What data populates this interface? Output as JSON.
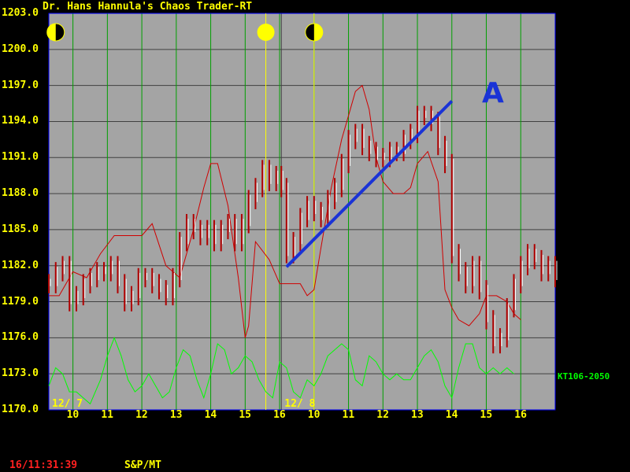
{
  "title": "Dr. Hans Hannula's Chaos Trader-RT",
  "bottom": {
    "timestamp": "16/11:31:39",
    "instrument": "S&P/MT"
  },
  "oscillator_label": "KT106-2050",
  "annotation_label": "A",
  "colors": {
    "plot_bg": "#a4a4a4",
    "price_bar": "#b00000",
    "price_bar_alt": "#ffffff",
    "red_curve": "#d00000",
    "green_curve": "#00ff00",
    "trendline": "#1a33d6",
    "grid_h": "#404040",
    "grid_v": "#00a000",
    "event_line": "#ffff00",
    "text": "#ffff00"
  },
  "chart_data": {
    "type": "line",
    "title": "Dr. Hans Hannula's Chaos Trader-RT",
    "ylim": [
      1170.0,
      1203.0
    ],
    "y_ticks": [
      "1170.0",
      "1173.0",
      "1176.0",
      "1179.0",
      "1182.0",
      "1185.0",
      "1188.0",
      "1191.0",
      "1194.0",
      "1197.0",
      "1200.0",
      "1203.0"
    ],
    "x_ticks": [
      "10",
      "11",
      "12",
      "13",
      "14",
      "15",
      "16",
      "10",
      "11",
      "12",
      "13",
      "14",
      "15",
      "16"
    ],
    "date_labels": [
      "12/ 7",
      "12/ 8"
    ],
    "x_domain": [
      9.3,
      24.0
    ],
    "x_tick_pos": [
      10,
      11,
      12,
      13,
      14,
      15,
      16,
      17,
      18,
      19,
      20,
      21,
      22,
      23
    ],
    "session_break": 16.05,
    "lunar_events": [
      {
        "x": 9.5,
        "phase": "last-quarter"
      },
      {
        "x": 15.6,
        "phase": "full"
      },
      {
        "x": 17.0,
        "phase": "first-quarter"
      }
    ],
    "yellow_event_lines": [
      15.6,
      17.0
    ],
    "trendline": {
      "x": [
        16.2,
        21.0
      ],
      "y": [
        1181.9,
        1195.7
      ],
      "label": "A"
    },
    "price_close": {
      "x": [
        9.3,
        9.5,
        9.7,
        9.9,
        10.1,
        10.3,
        10.5,
        10.7,
        10.9,
        11.1,
        11.3,
        11.5,
        11.7,
        11.9,
        12.1,
        12.3,
        12.5,
        12.7,
        12.9,
        13.1,
        13.3,
        13.5,
        13.7,
        13.9,
        14.1,
        14.3,
        14.5,
        14.7,
        14.9,
        15.1,
        15.3,
        15.5,
        15.7,
        15.9,
        16.05,
        16.2,
        16.4,
        16.6,
        16.8,
        17.0,
        17.2,
        17.4,
        17.6,
        17.8,
        18.0,
        18.2,
        18.4,
        18.6,
        18.8,
        19.0,
        19.2,
        19.4,
        19.6,
        19.8,
        20.0,
        20.2,
        20.4,
        20.6,
        20.8,
        21.0,
        21.2,
        21.4,
        21.6,
        21.8,
        22.0,
        22.2,
        22.4,
        22.6,
        22.8,
        23.0,
        23.2,
        23.4,
        23.6,
        23.8,
        24.0
      ],
      "y": [
        1180.5,
        1181.5,
        1182.0,
        1179.0,
        1179.5,
        1180.5,
        1181.0,
        1181.5,
        1181.5,
        1182.0,
        1180.5,
        1179.0,
        1179.5,
        1181.0,
        1181.0,
        1180.5,
        1180.0,
        1179.5,
        1181.0,
        1184.0,
        1185.5,
        1185.0,
        1184.5,
        1185.0,
        1184.0,
        1185.0,
        1185.5,
        1184.0,
        1185.5,
        1187.5,
        1188.5,
        1190.0,
        1189.0,
        1189.5,
        1188.5,
        1183.0,
        1184.0,
        1186.0,
        1187.0,
        1186.5,
        1186.0,
        1187.5,
        1188.5,
        1190.5,
        1192.5,
        1193.0,
        1192.0,
        1191.5,
        1191.0,
        1191.0,
        1191.5,
        1191.5,
        1192.5,
        1193.0,
        1194.5,
        1194.5,
        1194.0,
        1192.0,
        1190.5,
        1183.0,
        1181.5,
        1180.5,
        1182.0,
        1180.0,
        1177.5,
        1175.5,
        1176.0,
        1178.5,
        1180.5,
        1182.0,
        1183.0,
        1182.5,
        1181.5,
        1182.0,
        1181.0
      ]
    },
    "red_curve": {
      "x": [
        9.3,
        9.6,
        10.0,
        10.4,
        10.8,
        11.2,
        11.6,
        12.0,
        12.3,
        12.7,
        13.1,
        13.5,
        13.8,
        14.0,
        14.2,
        14.5,
        14.8,
        15.0,
        15.1,
        15.3,
        15.7,
        16.0,
        16.3,
        16.6,
        16.8,
        17.0,
        17.2,
        17.5,
        17.8,
        18.0,
        18.2,
        18.4,
        18.6,
        18.8,
        19.0,
        19.3,
        19.6,
        19.8,
        20.0,
        20.3,
        20.6,
        20.8,
        21.0,
        21.2,
        21.5,
        21.8,
        22.0,
        22.3,
        22.6,
        22.8,
        23.0
      ],
      "y": [
        1179.5,
        1179.5,
        1181.5,
        1181.0,
        1183.0,
        1184.5,
        1184.5,
        1184.5,
        1185.5,
        1182.0,
        1181.0,
        1185.0,
        1188.5,
        1190.5,
        1190.5,
        1187.0,
        1181.0,
        1176.0,
        1177.0,
        1184.0,
        1182.5,
        1180.5,
        1180.5,
        1180.5,
        1179.5,
        1180.0,
        1183.5,
        1188.5,
        1192.5,
        1194.5,
        1196.5,
        1197.0,
        1195.0,
        1191.0,
        1189.0,
        1188.0,
        1188.0,
        1188.5,
        1190.5,
        1191.5,
        1189.0,
        1180.0,
        1178.5,
        1177.5,
        1177.0,
        1178.0,
        1179.5,
        1179.5,
        1179.0,
        1178.0,
        1177.5
      ]
    },
    "green_curve": {
      "x": [
        9.3,
        9.5,
        9.7,
        9.9,
        10.1,
        10.3,
        10.5,
        10.8,
        11.0,
        11.2,
        11.4,
        11.6,
        11.8,
        12.0,
        12.2,
        12.4,
        12.6,
        12.8,
        13.0,
        13.2,
        13.4,
        13.6,
        13.8,
        14.0,
        14.2,
        14.4,
        14.6,
        14.8,
        15.0,
        15.2,
        15.4,
        15.6,
        15.8,
        16.0,
        16.2,
        16.4,
        16.6,
        16.8,
        17.0,
        17.2,
        17.4,
        17.6,
        17.8,
        18.0,
        18.2,
        18.4,
        18.6,
        18.8,
        19.0,
        19.2,
        19.4,
        19.6,
        19.8,
        20.0,
        20.2,
        20.4,
        20.6,
        20.8,
        21.0,
        21.2,
        21.4,
        21.6,
        21.8,
        22.0,
        22.2,
        22.4,
        22.6,
        22.8,
        23.0,
        23.2,
        23.4,
        23.6,
        23.8,
        24.0
      ],
      "y": [
        1172.0,
        1173.5,
        1173.0,
        1171.5,
        1171.5,
        1171.0,
        1170.5,
        1172.5,
        1174.5,
        1176.0,
        1174.5,
        1172.5,
        1171.5,
        1172.0,
        1173.0,
        1172.0,
        1171.0,
        1171.5,
        1173.5,
        1175.0,
        1174.5,
        1172.5,
        1171.0,
        1173.0,
        1175.5,
        1175.0,
        1173.0,
        1173.5,
        1174.5,
        1174.0,
        1172.5,
        1171.5,
        1171.0,
        1174.0,
        1173.5,
        1171.5,
        1171.0,
        1172.5,
        1172.0,
        1173.0,
        1174.5,
        1175.0,
        1175.5,
        1175.0,
        1172.5,
        1172.0,
        1174.5,
        1174.0,
        1173.0,
        1172.5,
        1173.0,
        1172.5,
        1172.5,
        1173.5,
        1174.5,
        1175.0,
        1174.0,
        1172.0,
        1171.0,
        1173.5,
        1175.5,
        1175.5,
        1173.5,
        1173.0,
        1173.5,
        1173.0,
        1173.5,
        1173.0
      ]
    }
  }
}
